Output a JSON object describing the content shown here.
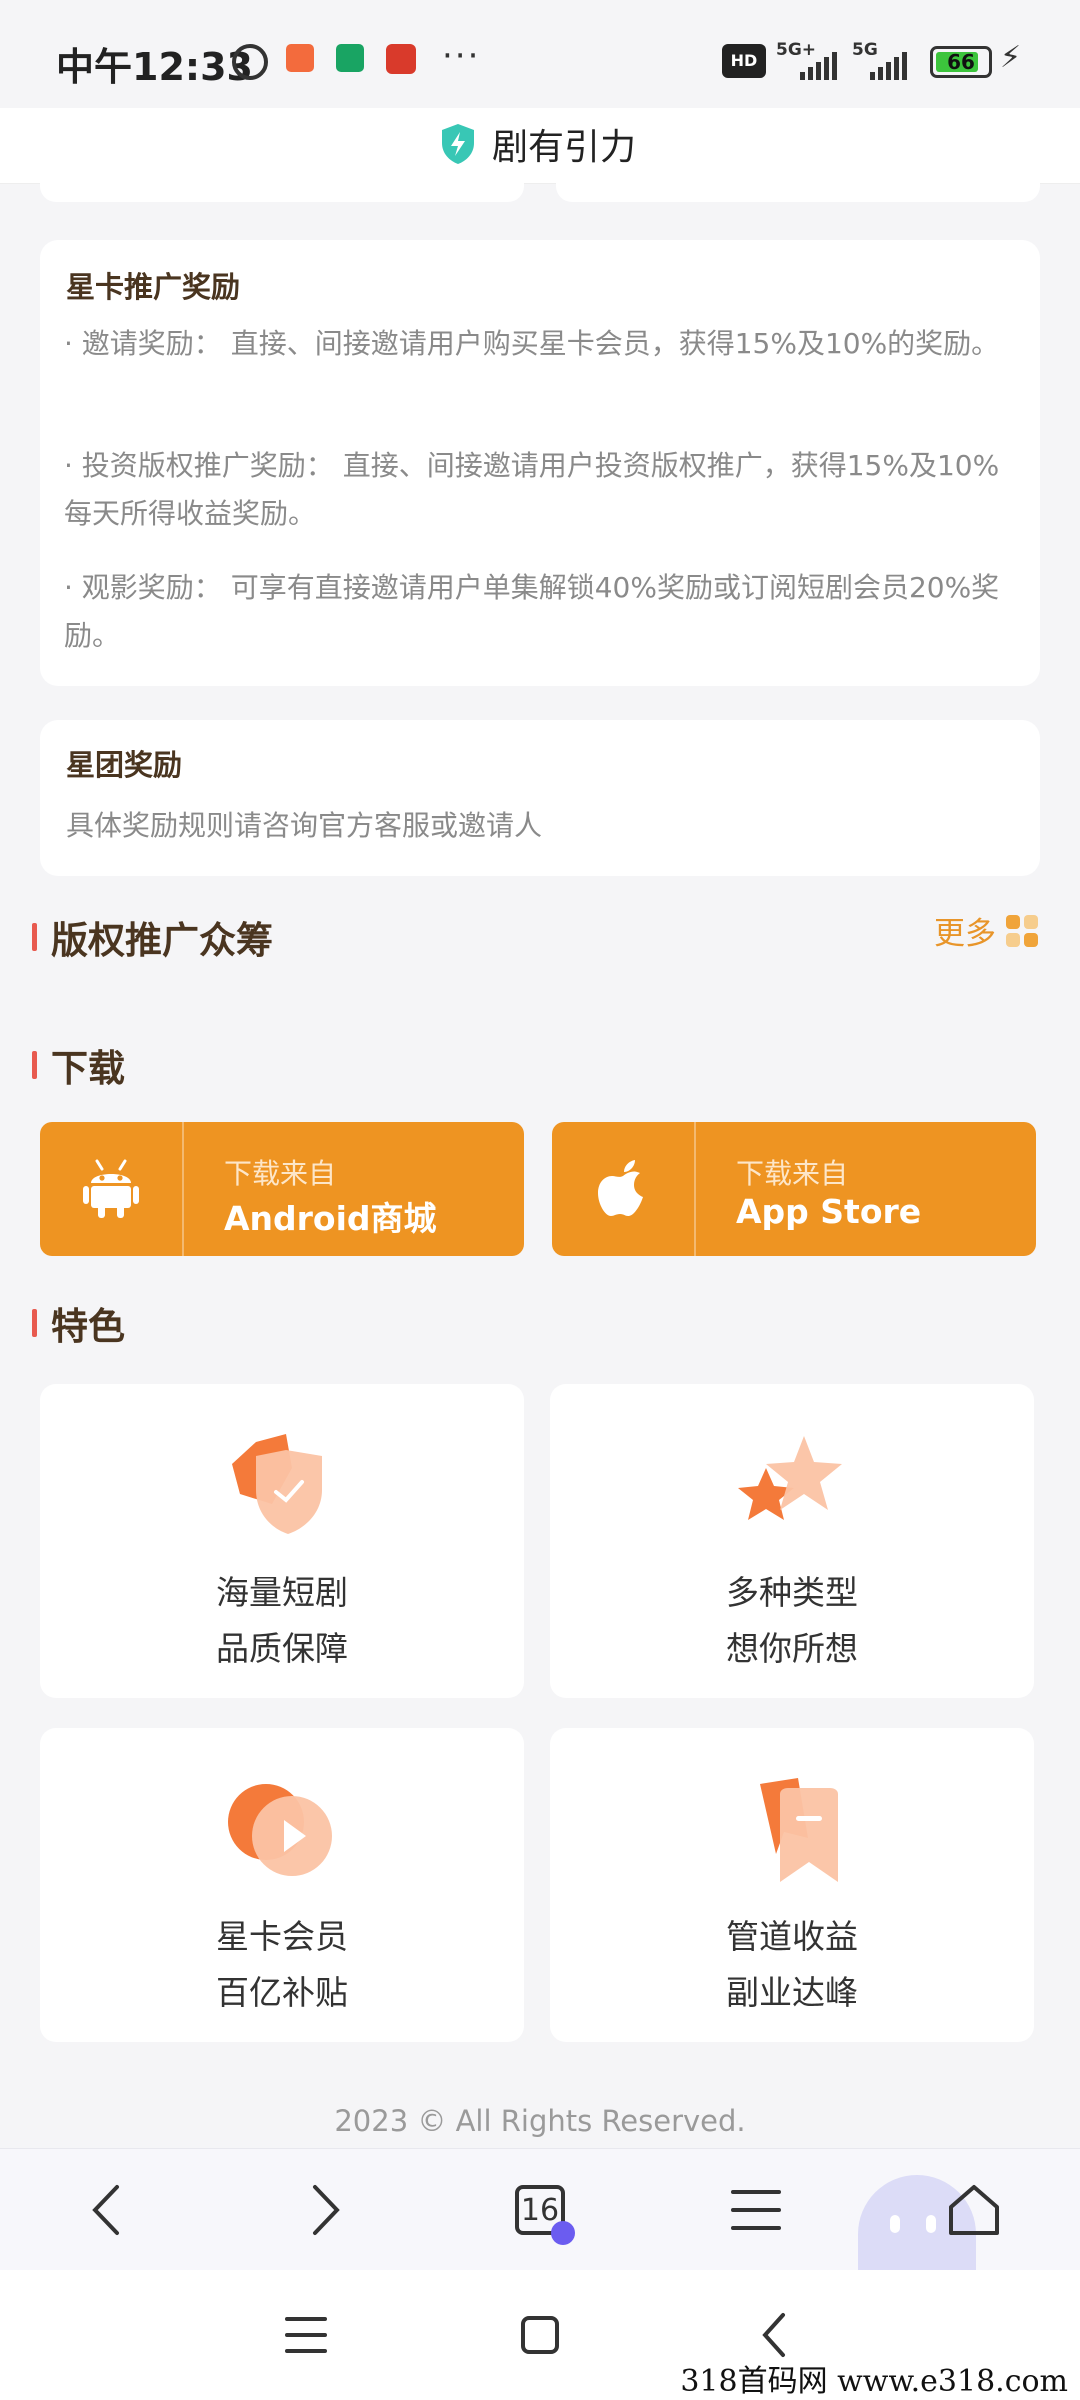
{
  "status_bar": {
    "time": "中午12:33",
    "dots": "···",
    "hd": "HD",
    "network1": "5G+",
    "network2": "5G",
    "battery": "66",
    "icons": [
      "alarm-icon",
      "app-notification-icon",
      "download-app-icon",
      "shopping-app-icon",
      "charging-icon"
    ]
  },
  "header": {
    "title": "剧有引力",
    "icon": "shield-bolt-icon",
    "accent": "#38c7b5"
  },
  "star_card_reward": {
    "title": "星卡推广奖励",
    "items": [
      "· 邀请奖励： 直接、间接邀请用户购买星卡会员，获得15%及10%的奖励。",
      "· 投资版权推广奖励： 直接、间接邀请用户投资版权推广，获得15%及10%每天所得收益奖励。",
      "· 观影奖励： 可享有直接邀请用户单集解锁40%奖励或订阅短剧会员20%奖励。"
    ]
  },
  "star_group_reward": {
    "title": "星团奖励",
    "text": "具体奖励规则请咨询官方客服或邀请人"
  },
  "crowdfunding": {
    "title": "版权推广众筹",
    "more": "更多"
  },
  "download": {
    "title": "下载",
    "buttons": [
      {
        "sub": "下载来自",
        "main": "Android商城",
        "icon": "android-icon"
      },
      {
        "sub": "下载来自",
        "main": "App Store",
        "icon": "apple-icon"
      }
    ],
    "color": "#ee9422"
  },
  "features": {
    "title": "特色",
    "items": [
      {
        "line1": "海量短剧",
        "line2": "品质保障",
        "icon": "shield-check-icon"
      },
      {
        "line1": "多种类型",
        "line2": "想你所想",
        "icon": "stars-icon"
      },
      {
        "line1": "星卡会员",
        "line2": "百亿补贴",
        "icon": "play-icon"
      },
      {
        "line1": "管道收益",
        "line2": "副业达峰",
        "icon": "bookmark-icon"
      }
    ]
  },
  "footer": {
    "copyright": "2023 © All Rights Reserved."
  },
  "browser_toolbar": {
    "tab_count": "16",
    "items": [
      "back-icon",
      "forward-icon",
      "tabs-icon",
      "menu-icon",
      "home-icon"
    ]
  },
  "system_nav": {
    "items": [
      "recents-icon",
      "home-square-icon",
      "back-nav-icon"
    ]
  },
  "watermark": "318首码网 www.e318.com"
}
